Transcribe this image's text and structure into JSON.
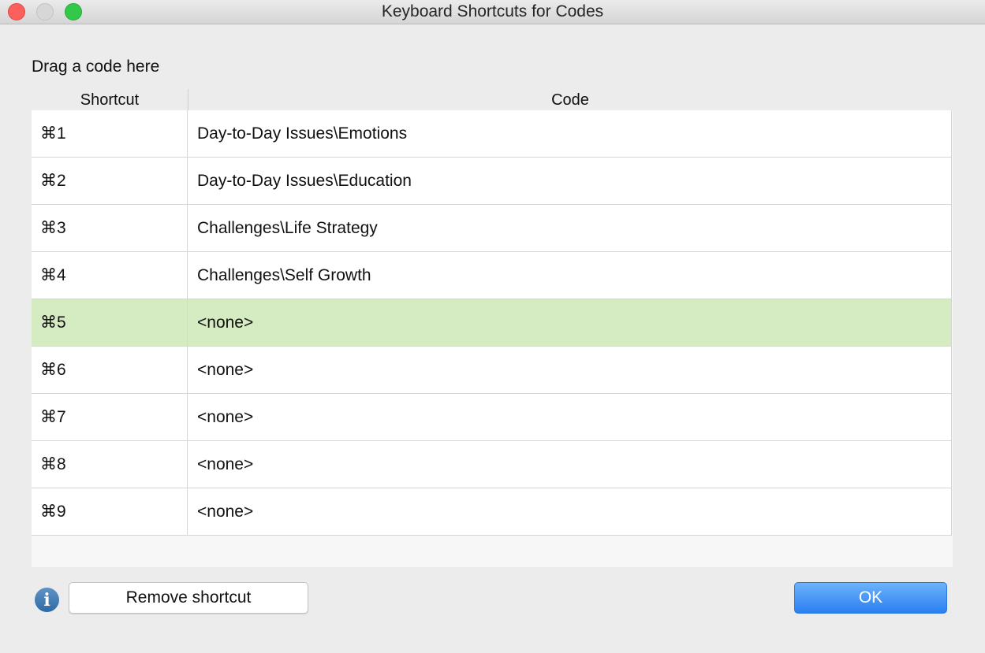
{
  "window": {
    "title": "Keyboard Shortcuts for Codes"
  },
  "drag_label": "Drag a code here",
  "table": {
    "headers": {
      "shortcut": "Shortcut",
      "code": "Code"
    },
    "rows": [
      {
        "shortcut": "⌘1",
        "code": "Day-to-Day Issues\\Emotions",
        "selected": false
      },
      {
        "shortcut": "⌘2",
        "code": "Day-to-Day Issues\\Education",
        "selected": false
      },
      {
        "shortcut": "⌘3",
        "code": "Challenges\\Life Strategy",
        "selected": false
      },
      {
        "shortcut": "⌘4",
        "code": "Challenges\\Self Growth",
        "selected": false
      },
      {
        "shortcut": "⌘5",
        "code": "<none>",
        "selected": true
      },
      {
        "shortcut": "⌘6",
        "code": "<none>",
        "selected": false
      },
      {
        "shortcut": "⌘7",
        "code": "<none>",
        "selected": false
      },
      {
        "shortcut": "⌘8",
        "code": "<none>",
        "selected": false
      },
      {
        "shortcut": "⌘9",
        "code": "<none>",
        "selected": false
      }
    ]
  },
  "footer": {
    "info_icon": "i",
    "remove_label": "Remove shortcut",
    "ok_label": "OK"
  },
  "colors": {
    "selected_row": "#d5ebc1",
    "ok_button": "#2a7ff2"
  }
}
